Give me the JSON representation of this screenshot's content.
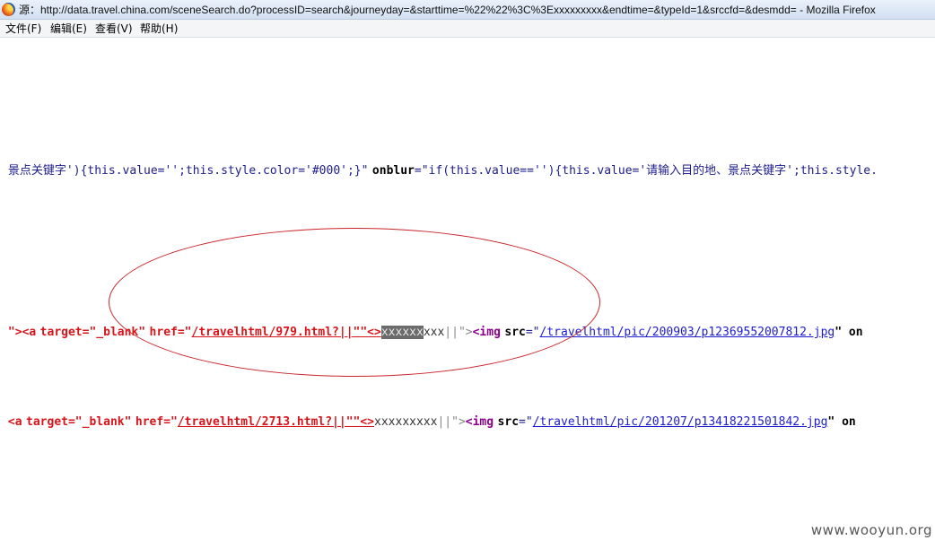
{
  "window": {
    "title": "源：http://data.travel.china.com/sceneSearch.do?processID=search&journeyday=&starttime=%22%22%3C%3Exxxxxxxxx&endtime=&typeId=1&srccfd=&desmdd= - Mozilla Firefox",
    "app_icon": "firefox-icon"
  },
  "menu": {
    "items": [
      "文件(F)",
      "编辑(E)",
      "查看(V)",
      "帮助(H)"
    ]
  },
  "source": {
    "line1": {
      "p1": "景点关键字')",
      "p2": "{this.value='';this.style.color='#000';}\"",
      "attr": "onblur",
      "eq": "=",
      "p3": "\"if(this.value=='')",
      "p4": "{this.value='请输入目的地、景点关键字';this.style."
    },
    "line2": {
      "start": "\">",
      "tag_open": "<a",
      "attr_target": "target",
      "val_target": "=\"_blank\"",
      "attr_href": "href",
      "href_eq": "=\"",
      "href_link": "/travelhtml/979.html?||\"\"<>",
      "hl_text": "xxxxxx",
      "rest_text": "xxx",
      "pipes": "||\">",
      "img_tag": "<img",
      "src_attr": "src",
      "src_eq": "=\"",
      "src_link": "/travelhtml/pic/200903/p12369552007812.jpg",
      "end": "\" on"
    },
    "line3": {
      "start": "<a",
      "attr_target": "target",
      "val_target": "=\"_blank\"",
      "attr_href": "href",
      "href_eq": "=\"",
      "href_link": "/travelhtml/2713.html?||\"\"<>",
      "text": "xxxxxxxxx",
      "pipes": "||\">",
      "img_tag": "<img",
      "src_attr": "src",
      "src_eq": "=\"",
      "src_link": "/travelhtml/pic/201207/p13418221501842.jpg",
      "end": "\" on"
    }
  },
  "watermark": "www.wooyun.org"
}
